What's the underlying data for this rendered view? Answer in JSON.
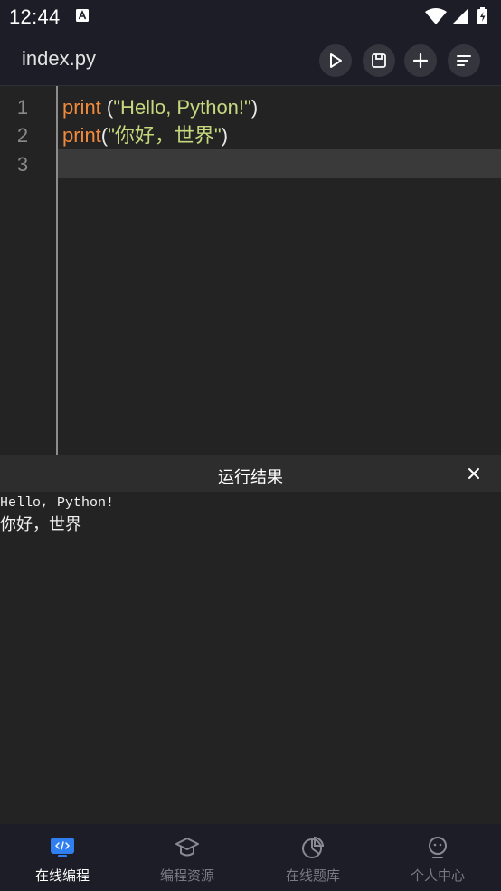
{
  "status_bar": {
    "time": "12:44",
    "notification_icon": "a-box-icon",
    "icons": [
      "wifi-icon",
      "signal-icon",
      "battery-icon"
    ]
  },
  "toolbar": {
    "filename": "index.py",
    "buttons": [
      "run-icon",
      "save-icon",
      "add-icon",
      "menu-icon"
    ]
  },
  "editor": {
    "line_numbers": [
      "1",
      "2",
      "3"
    ],
    "line1": {
      "kw": "print",
      "sp": " (",
      "str": "\"Hello, Python!\"",
      "end": ")"
    },
    "line2": {
      "kw": "print",
      "sp": "(",
      "str": "\"你好，世界\"",
      "end": ")"
    },
    "active_line": 3
  },
  "result": {
    "title": "运行结果",
    "output": [
      "Hello, Python!",
      "你好，世界"
    ]
  },
  "bottom_nav": {
    "items": [
      {
        "label": "在线编程",
        "icon": "monitor-code-icon",
        "active": true
      },
      {
        "label": "编程资源",
        "icon": "graduation-cap-icon",
        "active": false
      },
      {
        "label": "在线题库",
        "icon": "pie-chart-icon",
        "active": false
      },
      {
        "label": "个人中心",
        "icon": "person-icon",
        "active": false
      }
    ]
  },
  "colors": {
    "keyword": "#f28a3c",
    "string": "#c5d87e",
    "accent": "#2f7ff0"
  }
}
